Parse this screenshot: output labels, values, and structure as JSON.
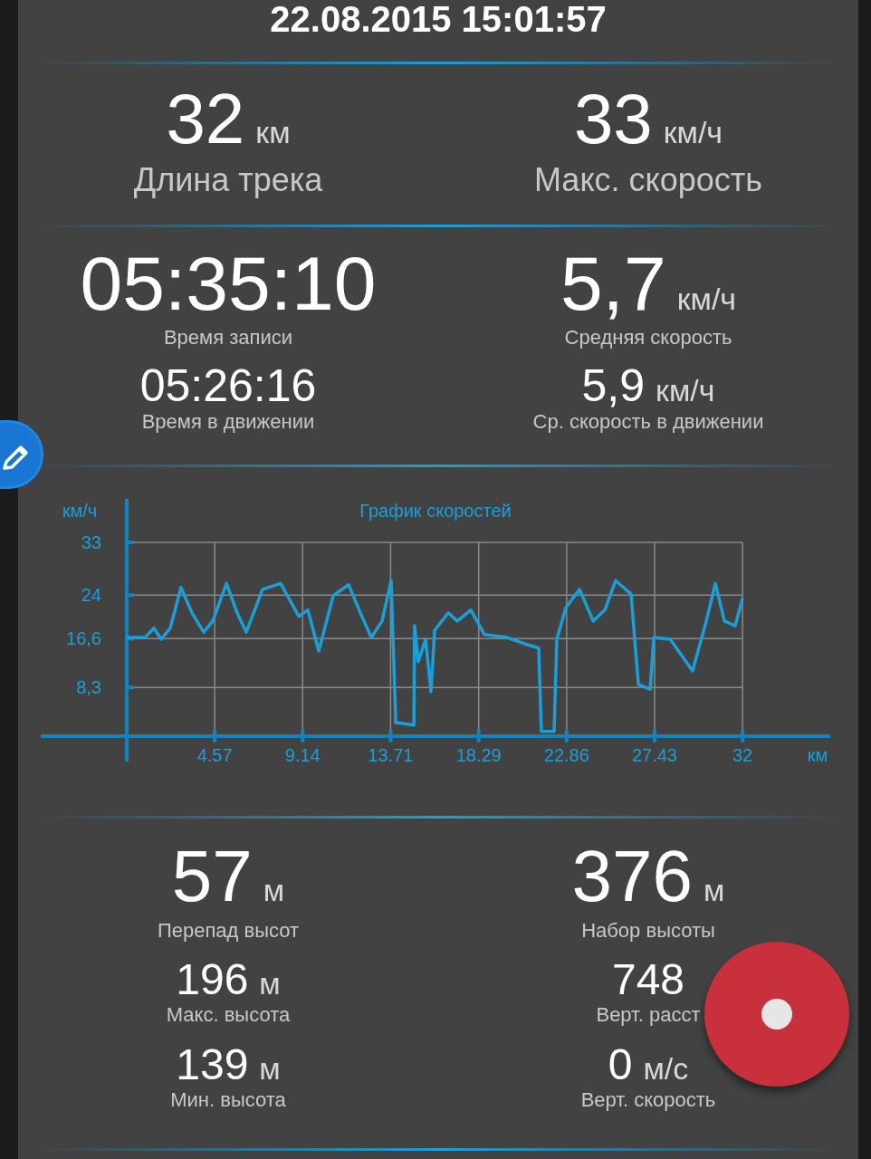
{
  "timestamp": "22.08.2015 15:01:57",
  "distance_speed": [
    {
      "items": [
        {
          "kind": "hero",
          "value": "32",
          "unit": "км",
          "label": "Длина трека"
        }
      ]
    },
    {
      "items": [
        {
          "kind": "hero",
          "value": "33",
          "unit": "км/ч",
          "label": "Макс. скорость"
        }
      ]
    }
  ],
  "times": [
    {
      "items": [
        {
          "kind": "primary",
          "value": "05:35:10",
          "label": "Время записи"
        },
        {
          "kind": "secondary",
          "value": "05:26:16",
          "label": "Время в движении"
        }
      ]
    },
    {
      "items": [
        {
          "kind": "primary",
          "value": "5,7",
          "unit": "км/ч",
          "label": "Средняя скорость"
        },
        {
          "kind": "secondary",
          "value": "5,9",
          "unit": "км/ч",
          "label": "Ср. скорость в движении"
        }
      ]
    }
  ],
  "speed_chart": {
    "chart_data": {
      "type": "line",
      "grid": true,
      "title": "График скоростей",
      "xlabel": "км",
      "ylabel": "км/ч",
      "xlim": [
        -4.47,
        36.56
      ],
      "ylim": [
        0,
        33
      ],
      "xticks": [
        4.57,
        9.14,
        13.71,
        18.29,
        22.86,
        27.43,
        32
      ],
      "yticks": [
        {
          "value": 8.3,
          "label": "8,3"
        },
        {
          "value": 16.6,
          "label": "16,6"
        },
        {
          "value": 24,
          "label": "24"
        },
        {
          "value": 33,
          "label": "33"
        }
      ],
      "x": [
        0,
        0.94,
        1.41,
        1.79,
        2.26,
        2.82,
        3.39,
        4.0,
        4.47,
        5.18,
        5.74,
        6.21,
        7.06,
        8.0,
        8.94,
        9.41,
        9.98,
        10.73,
        11.53,
        12.14,
        12.71,
        13.27,
        13.74,
        13.98,
        14.92,
        14.96,
        15.15,
        15.53,
        15.81,
        16.0,
        16.71,
        17.18,
        17.88,
        18.59,
        19.76,
        20.71,
        21.41,
        21.55,
        22.21,
        22.35,
        22.82,
        23.53,
        24.24,
        24.85,
        25.41,
        26.21,
        26.59,
        27.2,
        27.39,
        28.24,
        29.41,
        30.12,
        30.59,
        31.06,
        31.62,
        32
      ],
      "series": [
        {
          "color": "#1a9fd9",
          "values": [
            16.8,
            16.8,
            18.4,
            16.5,
            18.4,
            25.3,
            21,
            17.7,
            19.6,
            26,
            21,
            17.7,
            25,
            26,
            20.4,
            21.5,
            14.5,
            23.9,
            25.8,
            21,
            16.8,
            19.6,
            26.5,
            2.3,
            1.9,
            18.8,
            12.7,
            16.5,
            7.6,
            18,
            21,
            19.6,
            21.5,
            17.3,
            16.8,
            15.7,
            15,
            0.8,
            0.8,
            16.5,
            21.9,
            25,
            19.6,
            21.5,
            26.5,
            24.2,
            8.8,
            8,
            16.8,
            16.5,
            11.1,
            19.6,
            26,
            19.6,
            18.8,
            23.5
          ]
        }
      ]
    }
  },
  "altitude": [
    {
      "items": [
        {
          "kind": "primary",
          "value": "57",
          "unit": "м",
          "label": "Перепад высот"
        },
        {
          "kind": "secondary",
          "value": "196",
          "unit": "м",
          "label": "Макс. высота"
        },
        {
          "kind": "secondary",
          "value": "139",
          "unit": "м",
          "label": "Мин. высота"
        }
      ]
    },
    {
      "items": [
        {
          "kind": "primary",
          "value": "376",
          "unit": "м",
          "label": "Набор высоты"
        },
        {
          "kind": "secondary",
          "value": "748",
          "label": "Верт. расст"
        },
        {
          "kind": "secondary",
          "value": "0",
          "unit": "м/с",
          "label": "Верт. скорость"
        }
      ]
    }
  ]
}
